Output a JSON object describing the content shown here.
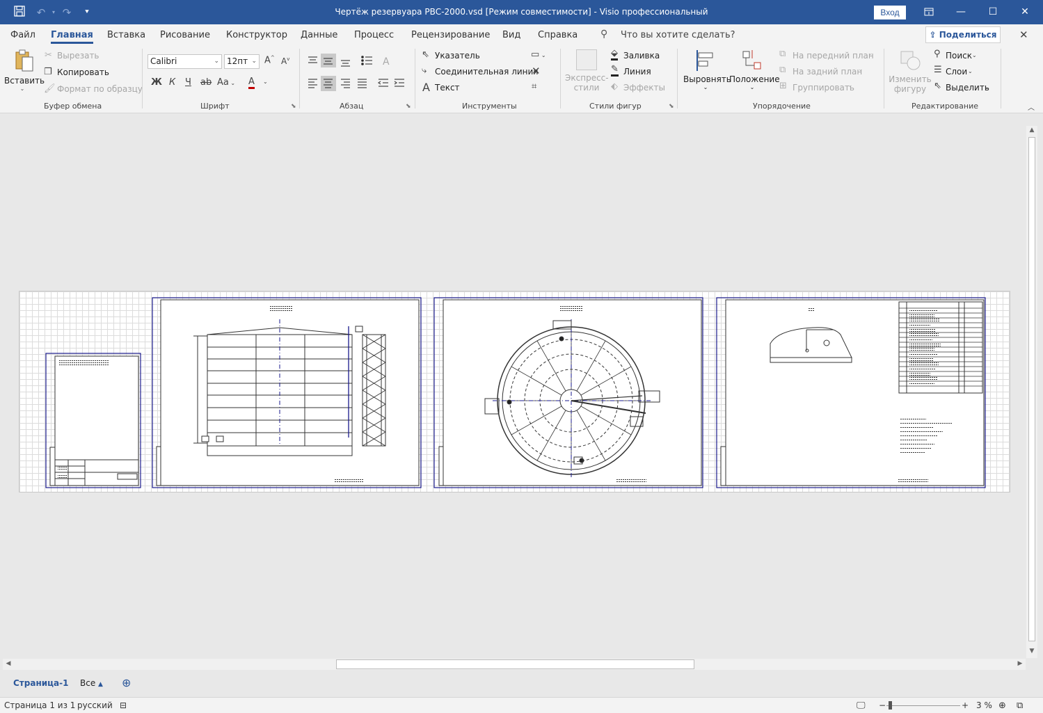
{
  "window": {
    "title": "Чертёж резервуара РВС-2000.vsd  [Режим совместимости]  -  Visio профессиональный",
    "login_label": "Вход",
    "minimize": "—",
    "restore": "☐",
    "close": "✕"
  },
  "menu": {
    "tabs": [
      "Файл",
      "Главная",
      "Вставка",
      "Рисование",
      "Конструктор",
      "Данные",
      "Процесс",
      "Рецензирование",
      "Вид",
      "Справка"
    ],
    "active_tab": "Главная",
    "tell_me": "Что вы хотите сделать?",
    "share": "Поделиться"
  },
  "ribbon": {
    "clipboard": {
      "paste": "Вставить",
      "cut": "Вырезать",
      "copy": "Копировать",
      "format_painter": "Формат по образцу",
      "label": "Буфер обмена"
    },
    "font": {
      "family": "Calibri",
      "size": "12пт",
      "bold": "Ж",
      "italic": "К",
      "underline": "Ч",
      "strike": "ab",
      "case": "Aa",
      "color": "A",
      "label": "Шрифт"
    },
    "paragraph": {
      "label": "Абзац"
    },
    "tools": {
      "pointer": "Указатель",
      "connector": "Соединительная линия",
      "text": "Текст",
      "label": "Инструменты"
    },
    "styles": {
      "quick_styles_line1": "Экспресс-",
      "quick_styles_line2": "стили",
      "fill": "Заливка",
      "line": "Линия",
      "effects": "Эффекты",
      "label": "Стили фигур"
    },
    "arrange": {
      "align": "Выровнять",
      "position": "Положение",
      "bring_front": "На передний план",
      "send_back": "На задний план",
      "group": "Группировать",
      "label": "Упорядочение"
    },
    "editing": {
      "change_shape_line1": "Изменить",
      "change_shape_line2": "фигуру",
      "find": "Поиск",
      "layers": "Слои",
      "select": "Выделить",
      "label": "Редактирование"
    }
  },
  "pages": {
    "current": "Страница-1",
    "all": "Все"
  },
  "status": {
    "page_info": "Страница 1 из 1",
    "language": "русский",
    "zoom": "3 %"
  },
  "colors": {
    "brand": "#2b579a",
    "drawing_frame": "#1a1a8c"
  }
}
